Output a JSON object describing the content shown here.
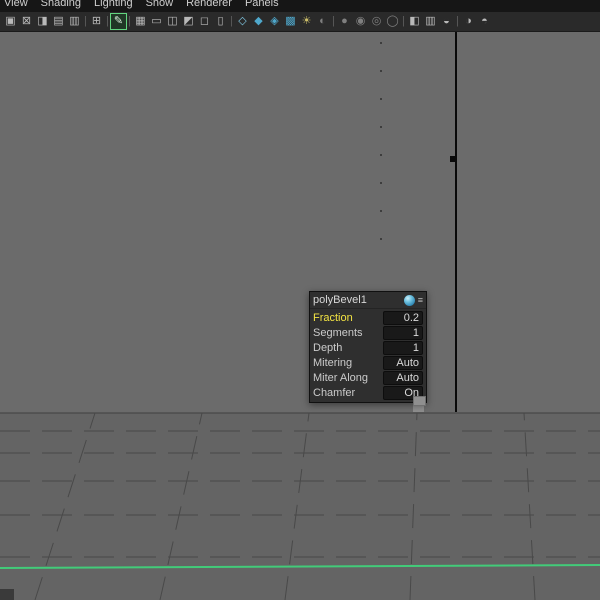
{
  "colors": {
    "viewport_bg": "#6b6b6b",
    "floor_bg": "#646464",
    "grid_line": "#494949",
    "selected_edge": "#42cb79",
    "edge_black": "#0a0a0a"
  },
  "menubar": {
    "items": [
      "View",
      "Shading",
      "Lighting",
      "Show",
      "Renderer",
      "Panels"
    ]
  },
  "toolbar": {
    "icons": [
      {
        "name": "camera-select-icon",
        "glyph": "▣"
      },
      {
        "name": "camera-lock-icon",
        "glyph": "⊠"
      },
      {
        "name": "camera-attributes-icon",
        "glyph": "◨"
      },
      {
        "name": "bookmark-icon",
        "glyph": "▤"
      },
      {
        "name": "image-plane-icon",
        "glyph": "▥"
      },
      {
        "name": "separator",
        "glyph": "|",
        "sep": true
      },
      {
        "name": "pan-zoom-icon",
        "glyph": "⊞"
      },
      {
        "name": "separator",
        "glyph": "|",
        "sep": true
      },
      {
        "name": "grease-pencil-icon",
        "glyph": "✎",
        "active": true
      },
      {
        "name": "separator",
        "glyph": "|",
        "sep": true
      },
      {
        "name": "grid-icon",
        "glyph": "▦"
      },
      {
        "name": "film-gate-icon",
        "glyph": "▭"
      },
      {
        "name": "resolution-gate-icon",
        "glyph": "◫"
      },
      {
        "name": "gate-mask-icon",
        "glyph": "◩"
      },
      {
        "name": "safe-action-icon",
        "glyph": "◻"
      },
      {
        "name": "safe-title-icon",
        "glyph": "▯"
      },
      {
        "name": "separator",
        "glyph": "|",
        "sep": true
      },
      {
        "name": "wireframe-icon",
        "glyph": "◇",
        "color": "#7fc4de"
      },
      {
        "name": "shaded-cube-icon",
        "glyph": "◆",
        "color": "#4fa8cc"
      },
      {
        "name": "wireframe-on-shaded-icon",
        "glyph": "◈",
        "color": "#4fa8cc"
      },
      {
        "name": "textured-icon",
        "glyph": "▩",
        "color": "#4fa8cc"
      },
      {
        "name": "use-all-lights-icon",
        "glyph": "☀",
        "color": "#cdbf6a"
      },
      {
        "name": "shadows-icon",
        "glyph": "◐",
        "color": "#7f7f7f"
      },
      {
        "name": "separator",
        "glyph": "|",
        "sep": true
      },
      {
        "name": "ao-icon",
        "glyph": "●",
        "color": "#7f7f7f"
      },
      {
        "name": "motion-blur-icon",
        "glyph": "◉",
        "color": "#7f7f7f"
      },
      {
        "name": "antialias-icon",
        "glyph": "◎",
        "color": "#7f7f7f"
      },
      {
        "name": "dof-icon",
        "glyph": "◯",
        "color": "#7f7f7f"
      },
      {
        "name": "separator",
        "glyph": "|",
        "sep": true
      },
      {
        "name": "isolate-select-icon",
        "glyph": "◧"
      },
      {
        "name": "xray-icon",
        "glyph": "▥"
      },
      {
        "name": "exposure-icon",
        "glyph": "◒"
      },
      {
        "name": "separator",
        "glyph": "|",
        "sep": true
      },
      {
        "name": "contrast-icon",
        "glyph": "◑"
      },
      {
        "name": "gamma-icon",
        "glyph": "◓"
      }
    ]
  },
  "popup": {
    "title": "polyBevel1",
    "menu_icon": "≡",
    "rows": [
      {
        "label": "Fraction",
        "value": "0.2",
        "highlighted": true
      },
      {
        "label": "Segments",
        "value": "1"
      },
      {
        "label": "Depth",
        "value": "1"
      },
      {
        "label": "Mitering",
        "value": "Auto"
      },
      {
        "label": "Miter Along",
        "value": "Auto"
      },
      {
        "label": "Chamfer",
        "value": "On"
      }
    ]
  }
}
